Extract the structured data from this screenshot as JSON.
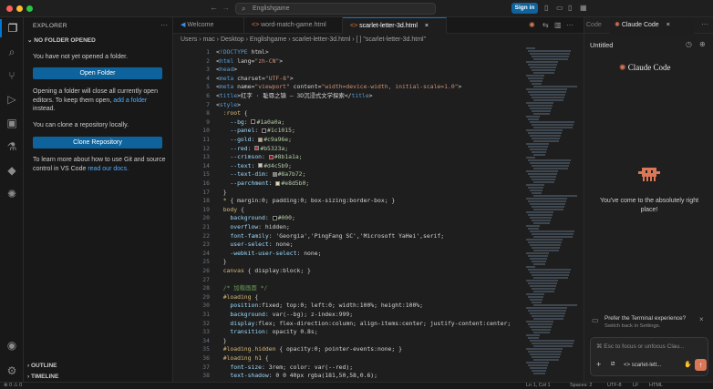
{
  "titlebar": {
    "command_center": "Englishgame",
    "sign_in": "Sign in",
    "dot_colors": [
      "#ff5f57",
      "#febc2e",
      "#28c840"
    ]
  },
  "sidebar": {
    "header": "EXPLORER",
    "section": "NO FOLDER OPENED",
    "msg1": "You have not yet opened a folder.",
    "open_folder": "Open Folder",
    "msg2_a": "Opening a folder will close all currently open editors. To keep them open,",
    "msg2_link": "add a folder",
    "msg2_b": "instead.",
    "msg3": "You can clone a repository locally.",
    "clone": "Clone Repository",
    "msg4_a": "To learn more about how to use Git and source control in VS Code",
    "msg4_link": "read our docs.",
    "outline": "OUTLINE",
    "timeline": "TIMELINE"
  },
  "tabs": [
    {
      "label": "Welcome"
    },
    {
      "label": "word-match-game.html"
    },
    {
      "label": "scarlet-letter-3d.html"
    }
  ],
  "breadcrumb": "Users › mac › Desktop › Englishgame › scarlet-letter-3d.html › [ ] \"scarlet-letter-3d.html\"",
  "code_lines": [
    {
      "n": "1",
      "t": "<!DOCTYPE html>"
    },
    {
      "n": "2",
      "t": "<html lang=\"zh-CN\">"
    },
    {
      "n": "3",
      "t": "<head>"
    },
    {
      "n": "4",
      "t": "<meta charset=\"UTF-8\">"
    },
    {
      "n": "5",
      "t": "<meta name=\"viewport\" content=\"width=device-width, initial-scale=1.0\">"
    },
    {
      "n": "6",
      "t": "<title>红字 · 耻辱之镇 — 3D沉浸式文学探索</title>"
    },
    {
      "n": "7",
      "t": "<style>"
    },
    {
      "n": "8",
      "t": "  :root {"
    },
    {
      "n": "9",
      "t": "    --bg: #1a0a0a;",
      "sw": "#1a0a0a"
    },
    {
      "n": "10",
      "t": "    --panel: #1c1015;",
      "sw": "#1c1015"
    },
    {
      "n": "11",
      "t": "    --gold: #c9a96e;",
      "sw": "#c9a96e"
    },
    {
      "n": "12",
      "t": "    --red: #b5323a;",
      "sw": "#b5323a"
    },
    {
      "n": "13",
      "t": "    --crimson: #8b1a1a;",
      "sw": "#8b1a1a"
    },
    {
      "n": "14",
      "t": "    --text: #d4c5b9;",
      "sw": "#d4c5b9"
    },
    {
      "n": "15",
      "t": "    --text-dim: #8a7b72;",
      "sw": "#8a7b72"
    },
    {
      "n": "16",
      "t": "    --parchment: #e8d5b0;",
      "sw": "#e8d5b0"
    },
    {
      "n": "17",
      "t": "  }"
    },
    {
      "n": "18",
      "t": "  * { margin:0; padding:0; box-sizing:border-box; }"
    },
    {
      "n": "19",
      "t": "  body {"
    },
    {
      "n": "20",
      "t": "    background: #000;",
      "sw": "#000000"
    },
    {
      "n": "21",
      "t": "    overflow: hidden;"
    },
    {
      "n": "22",
      "t": "    font-family: 'Georgia','PingFang SC','Microsoft YaHei',serif;"
    },
    {
      "n": "23",
      "t": "    user-select: none;"
    },
    {
      "n": "24",
      "t": "    -webkit-user-select: none;"
    },
    {
      "n": "25",
      "t": "  }"
    },
    {
      "n": "26",
      "t": "  canvas { display:block; }"
    },
    {
      "n": "27",
      "t": ""
    },
    {
      "n": "28",
      "t": "  /* 加载画面 */"
    },
    {
      "n": "29",
      "t": "  #loading {"
    },
    {
      "n": "30",
      "t": "    position:fixed; top:0; left:0; width:100%; height:100%;"
    },
    {
      "n": "31",
      "t": "    background: var(--bg); z-index:999;"
    },
    {
      "n": "32",
      "t": "    display:flex; flex-direction:column; align-items:center; justify-content:center;"
    },
    {
      "n": "33",
      "t": "    transition: opacity 0.8s;"
    },
    {
      "n": "34",
      "t": "  }"
    },
    {
      "n": "35",
      "t": "  #loading.hidden { opacity:0; pointer-events:none; }"
    },
    {
      "n": "36",
      "t": "  #loading h1 {"
    },
    {
      "n": "37",
      "t": "    font-size: 3rem; color: var(--red);"
    },
    {
      "n": "38",
      "t": "    text-shadow: 0 0 40px rgba(181,50,58,0.6);"
    }
  ],
  "right_panel": {
    "tab_prev": "Code",
    "tab": "Claude Code",
    "title": "Untitled",
    "brand": "Claude Code",
    "welcome": "You've come to the absolutely right place!",
    "tip_title": "Prefer the Terminal experience?",
    "tip_sub": "Switch back in Settings.",
    "input_placeholder": "⌘ Esc to focus or unfocus Clau...",
    "file_chip": "scarlet-lett...",
    "accent": "#d97757"
  },
  "statusbar": {
    "left": "⊗ 0 ⚠ 0",
    "ln": "Ln 1, Col 1",
    "spaces": "Spaces: 2",
    "enc": "UTF-8",
    "eol": "LF",
    "lang": "HTML"
  }
}
